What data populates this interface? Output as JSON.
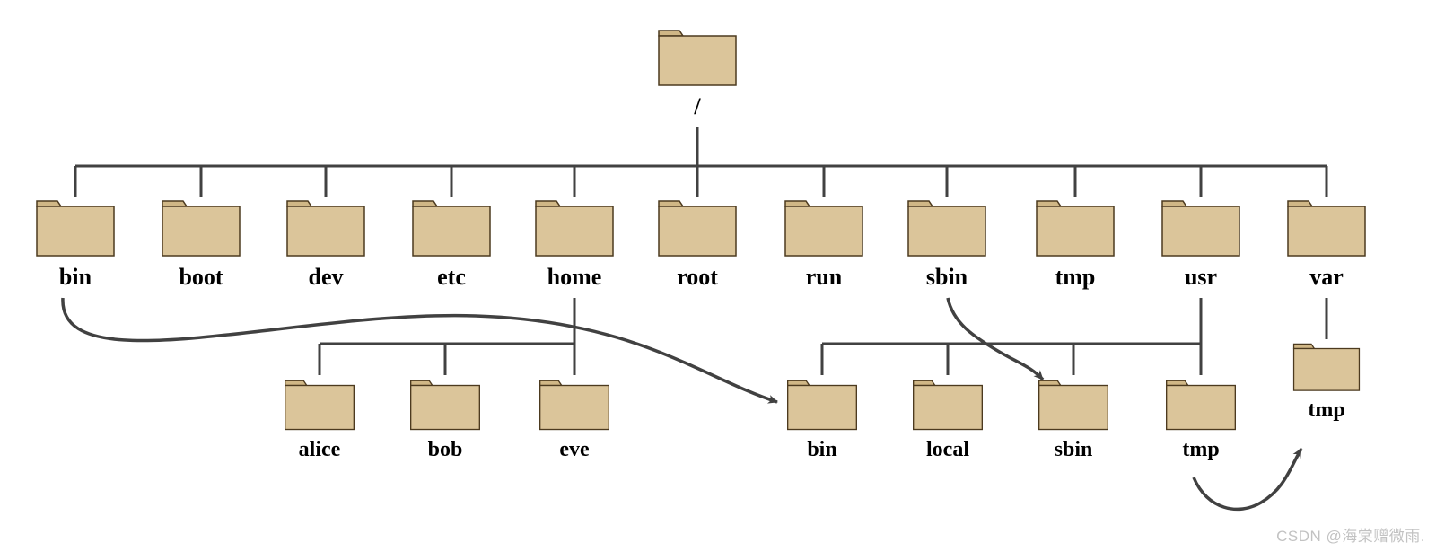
{
  "root": {
    "label": "/"
  },
  "level1": [
    {
      "label": "bin"
    },
    {
      "label": "boot"
    },
    {
      "label": "dev"
    },
    {
      "label": "etc"
    },
    {
      "label": "home"
    },
    {
      "label": "root"
    },
    {
      "label": "run"
    },
    {
      "label": "sbin"
    },
    {
      "label": "tmp"
    },
    {
      "label": "usr"
    },
    {
      "label": "var"
    }
  ],
  "home_children": [
    {
      "label": "alice"
    },
    {
      "label": "bob"
    },
    {
      "label": "eve"
    }
  ],
  "usr_children": [
    {
      "label": "bin"
    },
    {
      "label": "local"
    },
    {
      "label": "sbin"
    },
    {
      "label": "tmp"
    }
  ],
  "var_children": [
    {
      "label": "tmp"
    }
  ],
  "watermark": "CSDN @海棠赠微雨."
}
